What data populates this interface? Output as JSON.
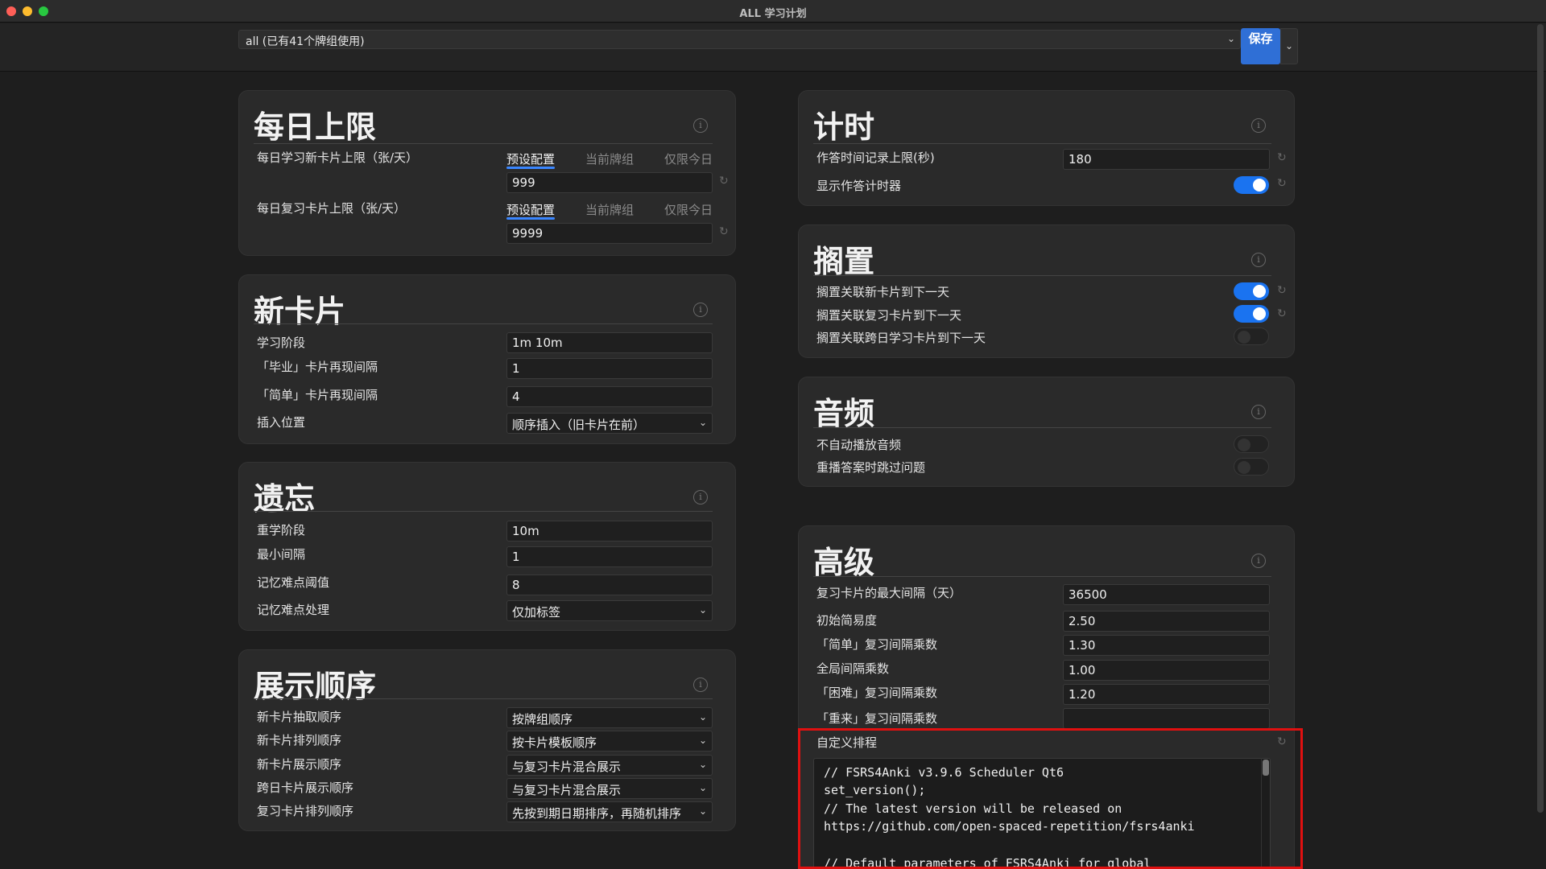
{
  "window": {
    "title": "ALL 学习计划"
  },
  "topbar": {
    "preset": "all (已有41个牌组使用)",
    "save_label": "保存"
  },
  "daily_limits": {
    "title": "每日上限",
    "tabs": [
      "预设配置",
      "当前牌组",
      "仅限今日"
    ],
    "new_label": "每日学习新卡片上限（张/天）",
    "new_value": "999",
    "review_label": "每日复习卡片上限（张/天）",
    "review_value": "9999"
  },
  "new_cards": {
    "title": "新卡片",
    "rows": [
      {
        "label": "学习阶段",
        "value": "1m 10m"
      },
      {
        "label": "「毕业」卡片再现间隔",
        "value": "1"
      },
      {
        "label": "「简单」卡片再现间隔",
        "value": "4"
      }
    ],
    "insert_label": "插入位置",
    "insert_value": "顺序插入（旧卡片在前）"
  },
  "lapses": {
    "title": "遗忘",
    "rows": [
      {
        "label": "重学阶段",
        "value": "10m"
      },
      {
        "label": "最小间隔",
        "value": "1"
      },
      {
        "label": "记忆难点阈值",
        "value": "8"
      }
    ],
    "leech_label": "记忆难点处理",
    "leech_value": "仅加标签"
  },
  "display_order": {
    "title": "展示顺序",
    "rows": [
      {
        "label": "新卡片抽取顺序",
        "value": "按牌组顺序"
      },
      {
        "label": "新卡片排列顺序",
        "value": "按卡片模板顺序"
      },
      {
        "label": "新卡片展示顺序",
        "value": "与复习卡片混合展示"
      },
      {
        "label": "跨日卡片展示顺序",
        "value": "与复习卡片混合展示"
      },
      {
        "label": "复习卡片排列顺序",
        "value": "先按到期日期排序，再随机排序"
      }
    ]
  },
  "timer": {
    "title": "计时",
    "max_answer_label": "作答时间记录上限(秒)",
    "max_answer_value": "180",
    "show_timer_label": "显示作答计时器",
    "show_timer_on": true
  },
  "burying": {
    "title": "搁置",
    "rows": [
      {
        "label": "搁置关联新卡片到下一天",
        "on": true
      },
      {
        "label": "搁置关联复习卡片到下一天",
        "on": true
      },
      {
        "label": "搁置关联跨日学习卡片到下一天",
        "on": false
      }
    ]
  },
  "audio": {
    "title": "音频",
    "rows": [
      {
        "label": "不自动播放音频",
        "on": false
      },
      {
        "label": "重播答案时跳过问题",
        "on": false
      }
    ]
  },
  "advanced": {
    "title": "高级",
    "rows": [
      {
        "label": "复习卡片的最大间隔（天）",
        "value": "36500"
      },
      {
        "label": "初始简易度",
        "value": "2.50"
      },
      {
        "label": "「简单」复习间隔乘数",
        "value": "1.30"
      },
      {
        "label": "全局间隔乘数",
        "value": "1.00"
      },
      {
        "label": "「困难」复习间隔乘数",
        "value": "1.20"
      },
      {
        "label": "「重来」复习间隔乘数",
        "value": ""
      }
    ],
    "custom_label": "自定义排程",
    "code_lines": [
      "// FSRS4Anki v3.9.6 Scheduler Qt6",
      "set_version();",
      "// The latest version will be released on",
      "https://github.com/open-spaced-repetition/fsrs4anki",
      "",
      "// Default parameters of FSRS4Anki for global"
    ]
  }
}
